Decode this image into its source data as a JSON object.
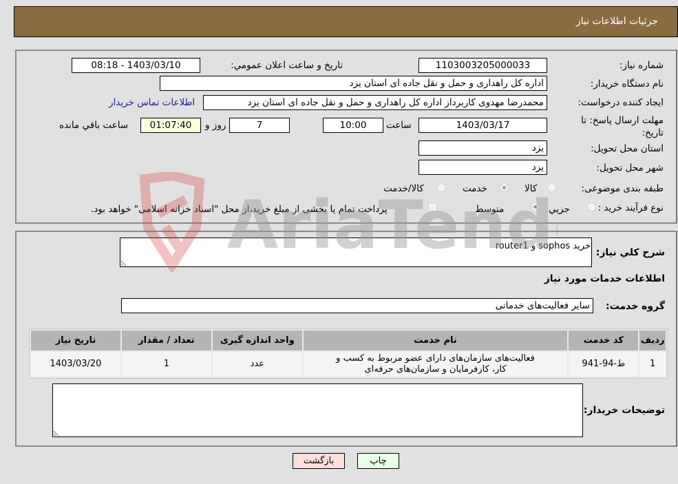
{
  "header": {
    "title": "جزئیات اطلاعات نیاز"
  },
  "form": {
    "need_number_label": "شماره نیاز:",
    "need_number": "1103003205000033",
    "announce_label": "تاریخ و ساعت اعلان عمومي:",
    "announce_value": "1403/03/10 - 08:18",
    "buyer_org_label": "نام دستگاه خریدار:",
    "buyer_org": "اداره کل راهداری و حمل و نقل جاده ای استان یزد",
    "creator_label": "ایجاد کننده درخواست:",
    "creator": "محمدرضا مهدوی کاربرداز اداره کل راهداری و حمل و نقل جاده ای استان یزد",
    "contact_link": "اطلاعات تماس خریدار",
    "deadline_label": "مهلت ارسال پاسخ: تا تاریخ:",
    "deadline_date": "1403/03/17",
    "time_label": "ساعت",
    "deadline_time": "10:00",
    "days_value": "7",
    "days_label": "روز و",
    "remaining_time": "01:07:40",
    "remaining_label": "ساعت باقي مانده",
    "province_label": "استان محل تحویل:",
    "province": "یزد",
    "city_label": "شهر محل تحویل:",
    "city": "یزد",
    "category_label": "طبقه بندی موضوعی:",
    "category_options": [
      "کالا",
      "خدمت",
      "کالا/خدمت"
    ],
    "category_selected": "خدمت",
    "process_label": "نوع فرآیند خرید :",
    "process_options": [
      "جزيي",
      "متوسط"
    ],
    "process_selected": "متوسط",
    "treasury_note": "پرداخت تمام یا بخشی از مبلغ خرید،از محل \"اسناد خزانه اسلامی\" خواهد بود."
  },
  "details": {
    "description_label": "شرح کلي نیاز:",
    "description": "خرید sophos و router1",
    "services_heading": "اطلاعات خدمات مورد نیاز",
    "service_group_label": "گروه خدمت:",
    "service_group": "سایر فعالیت‌های خدماتی",
    "table": {
      "headers": [
        "ردیف",
        "کد خدمت",
        "نام خدمت",
        "واحد اندازه گیری",
        "تعداد / مقدار",
        "تاریخ نیاز"
      ],
      "rows": [
        {
          "row": "1",
          "code": "ط-94-941",
          "name": "فعالیت‌های سازمان‌های دارای عضو مربوط به کسب و کار، کارفرمایان و سازمان‌های حرفه‌ای",
          "unit": "عدد",
          "qty": "1",
          "date": "1403/03/20"
        }
      ]
    },
    "buyer_notes_label": "توضیحات خریدار:",
    "buyer_notes": ""
  },
  "buttons": {
    "print": "چاپ",
    "back": "بازگشت"
  },
  "watermark": {
    "text": "AriaTender.neT"
  },
  "colors": {
    "header": "#8b6c42",
    "print_bg": "#eaffea",
    "back_bg": "#ffdede",
    "link": "#1a1aa6"
  }
}
